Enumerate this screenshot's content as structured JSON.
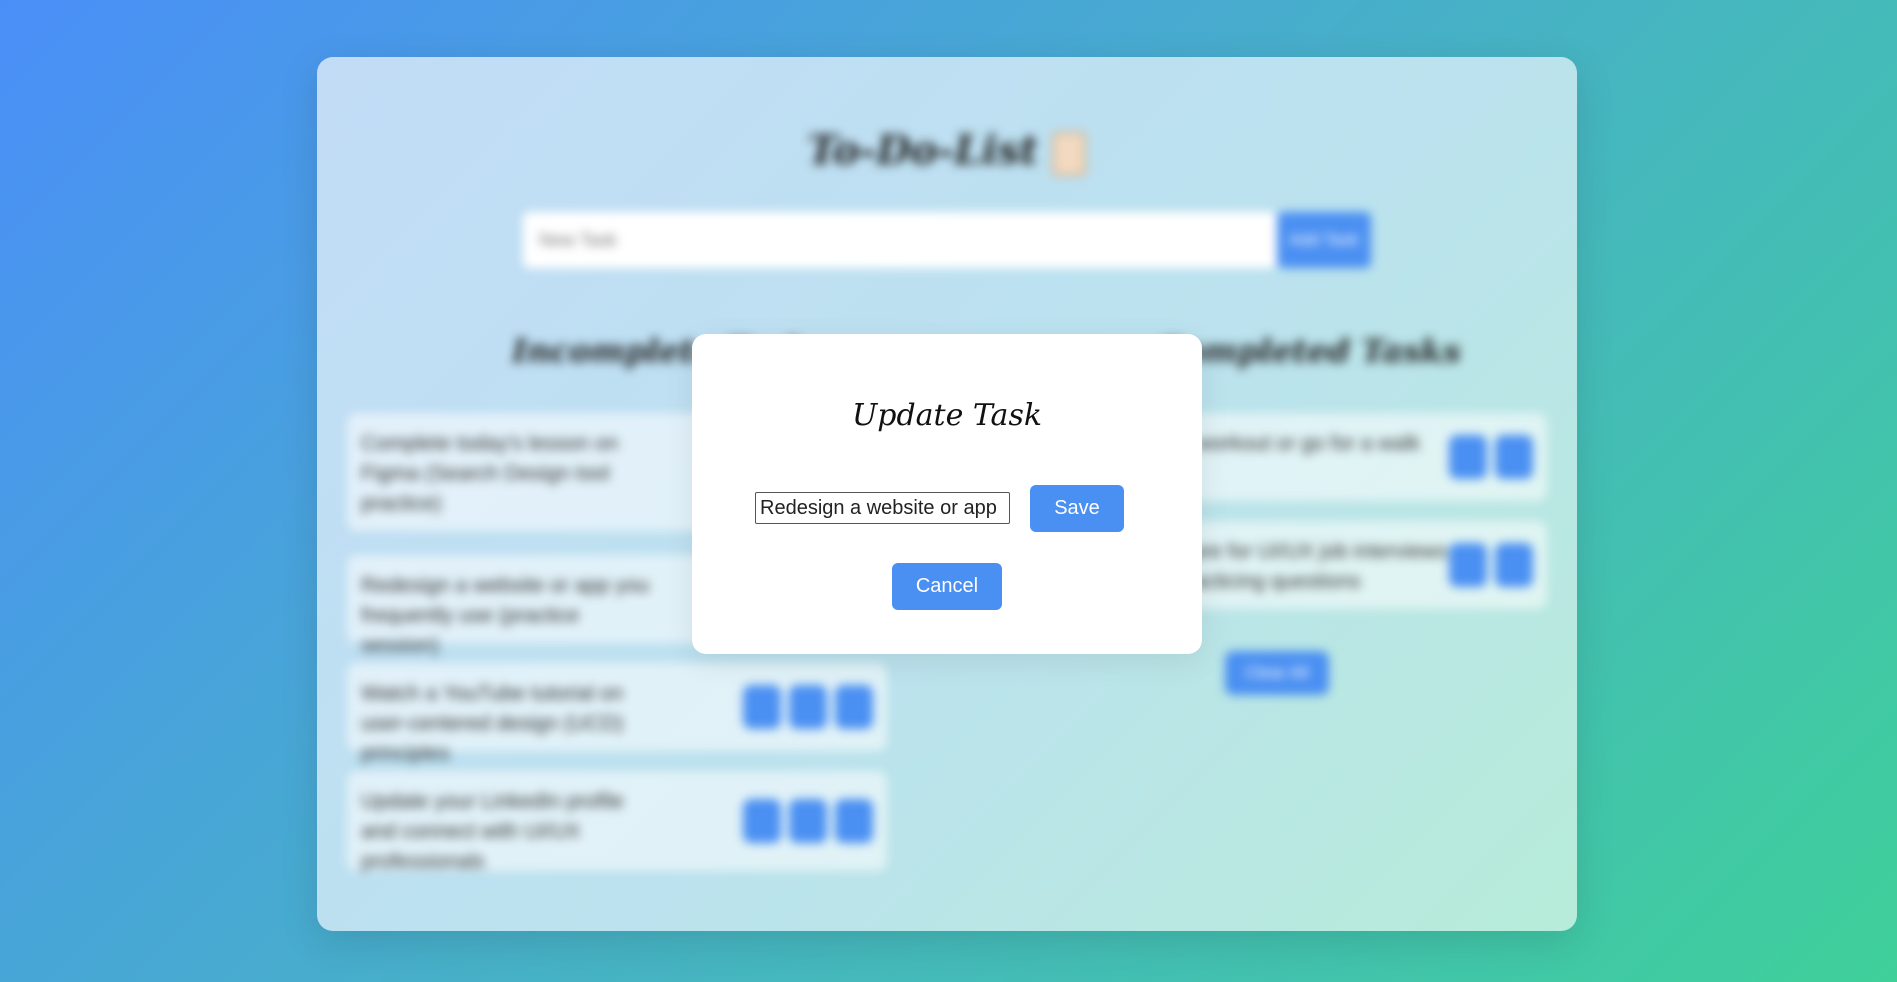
{
  "app": {
    "title": "To-Do-List",
    "clipboard_icon": "clipboard-icon",
    "new_task_placeholder": "New Task",
    "add_task_label": "Add Task",
    "incomplete_heading": "Incomplete Tasks",
    "completed_heading": "Completed Tasks",
    "clear_label": "Clear All"
  },
  "incomplete_tasks": [
    {
      "text": "Complete today's lesson on Figma (Search Design tool practice)"
    },
    {
      "text": "Redesign a website or app you frequently use (practice session)"
    },
    {
      "text": "Watch a YouTube tutorial on user-centered design (UCD) principles"
    },
    {
      "text": "Update your LinkedIn profile and connect with UI/UX professionals"
    }
  ],
  "completed_tasks": [
    {
      "text": "Do a workout or go for a walk"
    },
    {
      "text": "Prepare for UI/UX job interviews by practicing questions"
    }
  ],
  "modal": {
    "title": "Update Task",
    "input_value": "Redesign a website or app",
    "save_label": "Save",
    "cancel_label": "Cancel"
  },
  "colors": {
    "accent": "#4a8ff2"
  }
}
